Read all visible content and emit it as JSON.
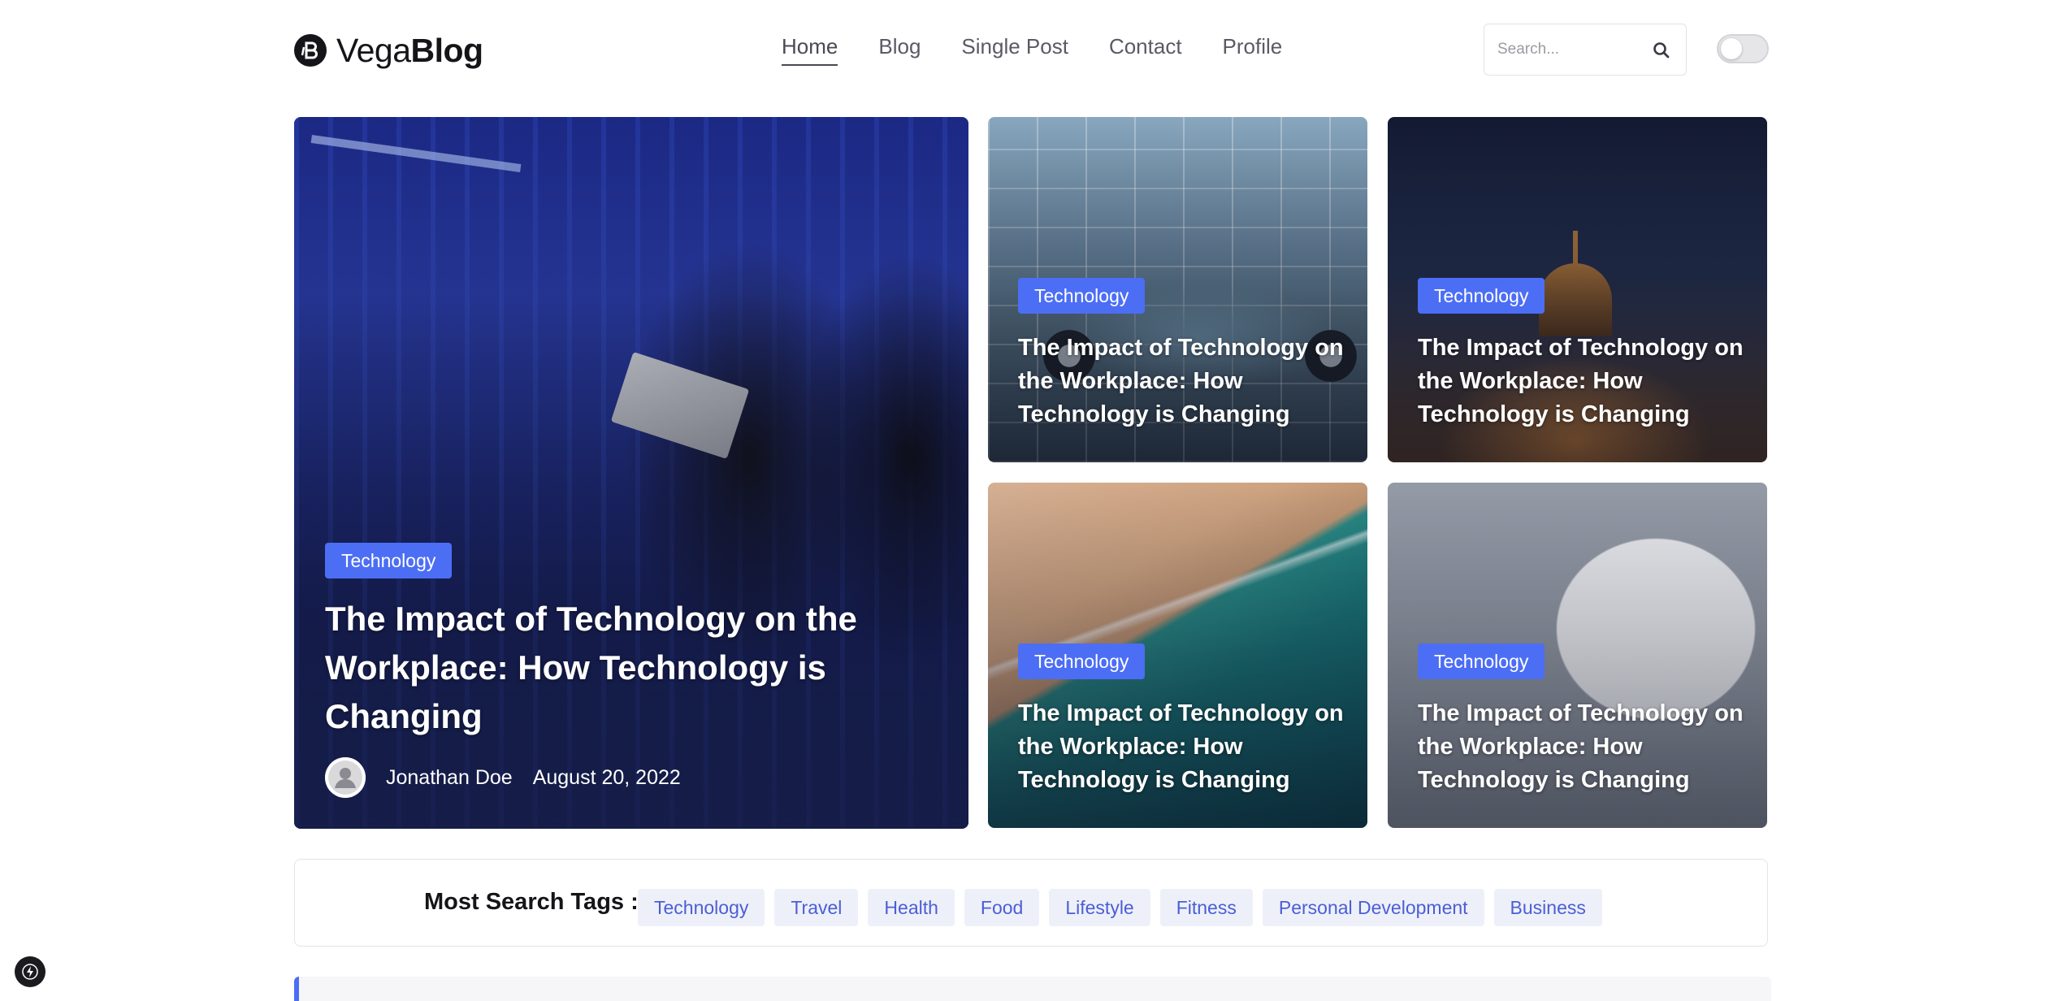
{
  "brand": {
    "name_light": "Vega",
    "name_bold": "Blog",
    "icon": "b-logo-icon"
  },
  "nav": {
    "items": [
      {
        "label": "Home",
        "active": true
      },
      {
        "label": "Blog",
        "active": false
      },
      {
        "label": "Single Post",
        "active": false
      },
      {
        "label": "Contact",
        "active": false
      },
      {
        "label": "Profile",
        "active": false
      }
    ]
  },
  "search": {
    "placeholder": "Search...",
    "value": "",
    "icon": "search-icon"
  },
  "theme_toggle": {
    "on": false
  },
  "featured": {
    "badge": "Technology",
    "title": "The Impact of Technology on the Workplace: How Technology is Changing",
    "author": "Jonathan Doe",
    "date": "August 20, 2022"
  },
  "cards": [
    {
      "badge": "Technology",
      "title": "The Impact of Technology on the Workplace: How Technology is Changing"
    },
    {
      "badge": "Technology",
      "title": "The Impact of Technology on the Workplace: How Technology is Changing"
    },
    {
      "badge": "Technology",
      "title": "The Impact of Technology on the Workplace: How Technology is Changing"
    },
    {
      "badge": "Technology",
      "title": "The Impact of Technology on the Workplace: How Technology is Changing"
    }
  ],
  "tags_section": {
    "title": "Most Search Tags :",
    "tags": [
      "Technology",
      "Travel",
      "Health",
      "Food",
      "Lifestyle",
      "Fitness",
      "Personal Development",
      "Business"
    ]
  },
  "colors": {
    "accent": "#4c6ef5",
    "tag_bg": "#eef0f9",
    "tag_text": "#4b5ed6",
    "text_dark": "#151519"
  }
}
